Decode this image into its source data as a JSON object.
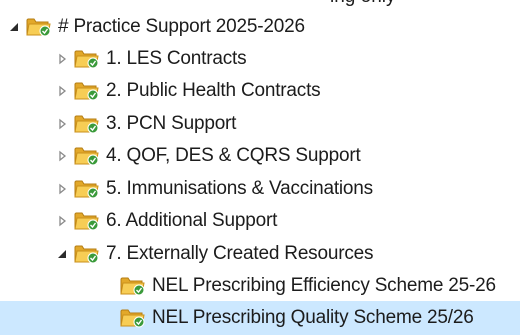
{
  "top_fragment": "ing only",
  "colors": {
    "selection_background": "#cce8ff",
    "folder_fill": "#f5c542",
    "folder_badge": "#3a9a3a"
  },
  "tree": {
    "items": [
      {
        "label": "# Practice Support 2025-2026",
        "expander": "expanded",
        "level": 0,
        "selected": false
      },
      {
        "label": "1. LES Contracts",
        "expander": "collapsed",
        "level": 1,
        "selected": false
      },
      {
        "label": "2. Public Health Contracts",
        "expander": "collapsed",
        "level": 1,
        "selected": false
      },
      {
        "label": "3. PCN Support",
        "expander": "collapsed",
        "level": 1,
        "selected": false
      },
      {
        "label": "4. QOF, DES & CQRS Support",
        "expander": "collapsed",
        "level": 1,
        "selected": false
      },
      {
        "label": "5. Immunisations & Vaccinations",
        "expander": "collapsed",
        "level": 1,
        "selected": false
      },
      {
        "label": "6. Additional Support",
        "expander": "collapsed",
        "level": 1,
        "selected": false
      },
      {
        "label": "7. Externally Created Resources",
        "expander": "expanded",
        "level": 1,
        "selected": false
      },
      {
        "label": "NEL Prescribing Efficiency Scheme 25-26",
        "expander": "none",
        "level": 2,
        "selected": false
      },
      {
        "label": "NEL Prescribing Quality Scheme 25/26",
        "expander": "none",
        "level": 2,
        "selected": true
      }
    ]
  }
}
